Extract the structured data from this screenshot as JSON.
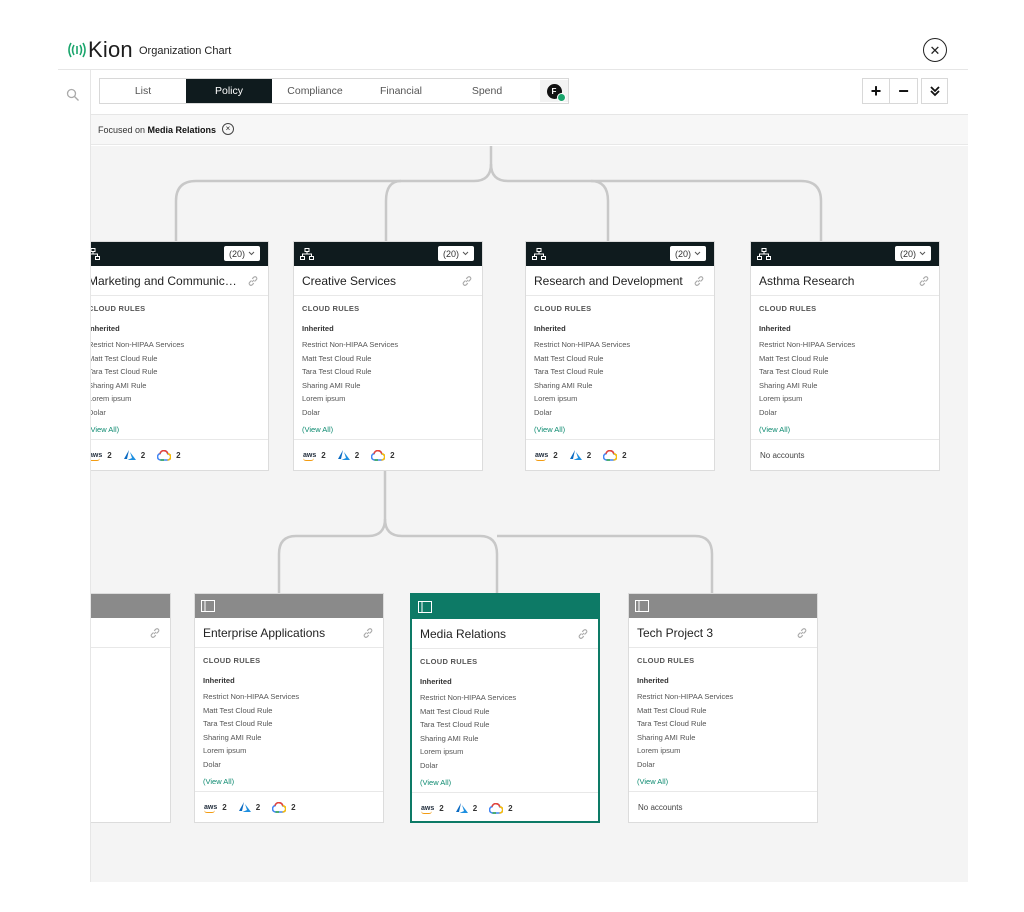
{
  "header": {
    "brand": "Kion",
    "title": "Organization Chart",
    "close_label": "✕"
  },
  "toolbar": {
    "tabs": [
      {
        "label": "List",
        "active": false
      },
      {
        "label": "Policy",
        "active": true
      },
      {
        "label": "Compliance",
        "active": false
      },
      {
        "label": "Financial",
        "active": false
      },
      {
        "label": "Spend",
        "active": false
      }
    ],
    "avatar_initial": "F",
    "zoom_in": "+",
    "zoom_out": "−"
  },
  "focus": {
    "prefix": "Focused on",
    "name": "Media Relations",
    "clear": "×"
  },
  "rules_heading": "CLOUD RULES",
  "rules_inherited": "Inherited",
  "rule_items": [
    "Restrict Non-HIPAA Services",
    "Matt Test Cloud Rule",
    "Tara Test Cloud Rule",
    "Sharing AMI Rule",
    "Lorem ipsum",
    "Dolar"
  ],
  "view_all": "(View All)",
  "no_accounts": "No accounts",
  "count_label": "(20)",
  "colors": {
    "accent": "#0d7a66",
    "dark_header": "#0f1b1e",
    "gray_header": "#8a8a8a"
  },
  "cards": [
    {
      "title": "Marketing and Communications",
      "type": "ou",
      "aws": "2",
      "azure": "2",
      "gcp": "2"
    },
    {
      "title": "Creative Services",
      "type": "ou",
      "aws": "2",
      "azure": "2",
      "gcp": "2"
    },
    {
      "title": "Research and Development",
      "type": "ou",
      "aws": "2",
      "azure": "2",
      "gcp": "2"
    },
    {
      "title": "Asthma Research",
      "type": "ou",
      "accounts": "none"
    },
    {
      "title": "",
      "type": "project"
    },
    {
      "title": "Enterprise Applications",
      "type": "project",
      "aws": "2",
      "azure": "2",
      "gcp": "2"
    },
    {
      "title": "Media Relations",
      "type": "project",
      "focused": true,
      "aws": "2",
      "azure": "2",
      "gcp": "2"
    },
    {
      "title": "Tech Project 3",
      "type": "project",
      "accounts": "none"
    }
  ]
}
